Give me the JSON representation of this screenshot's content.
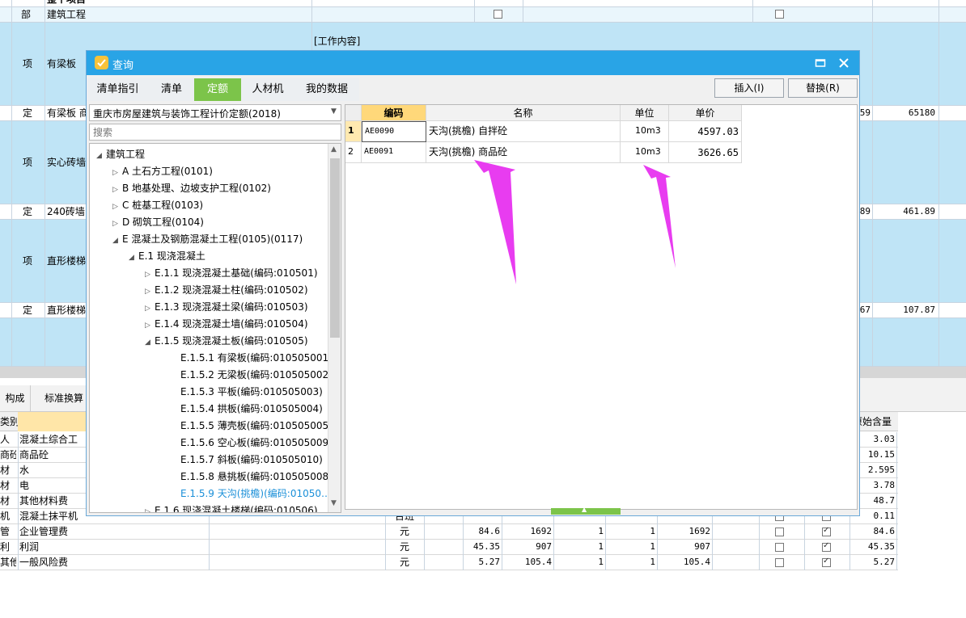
{
  "background": {
    "rows": [
      {
        "type": "部",
        "name": "建筑工程"
      },
      {
        "type": "项",
        "name": "有梁板",
        "content": "[工作内容]"
      },
      {
        "type": "定",
        "name": "有梁板 商",
        "v1": "59",
        "v2": "65180"
      },
      {
        "type": "项",
        "name": "实心砖墙"
      },
      {
        "type": "定",
        "name": "240砖墙",
        "v1": "89",
        "v2": "461.89"
      },
      {
        "type": "项",
        "name": "直形楼梯"
      },
      {
        "type": "定",
        "name": "直形楼梯",
        "v1": "67",
        "v2": "107.87"
      }
    ],
    "header_top": "整个项目",
    "bottom_tabs": [
      "构成",
      "标准换算"
    ],
    "bottom_header": {
      "col1": "类别",
      "last": "原始含量"
    },
    "bottom_rows": [
      {
        "type": "人",
        "name": "混凝土综合工",
        "unit": "",
        "price": "",
        "total": "",
        "q": "",
        "qty": "",
        "amount": "",
        "c1": false,
        "c2": false,
        "orig": "3.03"
      },
      {
        "type": "商砼",
        "name": "商品砼",
        "unit": "",
        "price": "",
        "total": "",
        "q": "",
        "qty": "",
        "amount": "",
        "c1": false,
        "c2": false,
        "orig": "10.15"
      },
      {
        "type": "材",
        "name": "水",
        "unit": "",
        "price": "",
        "total": "",
        "q": "",
        "qty": "",
        "amount": "",
        "c1": false,
        "c2": false,
        "orig": "2.595"
      },
      {
        "type": "材",
        "name": "电",
        "unit": "",
        "price": "",
        "total": "",
        "q": "",
        "qty": "",
        "amount": "",
        "c1": false,
        "c2": false,
        "orig": "3.78"
      },
      {
        "type": "材",
        "name": "其他材料费",
        "unit": "",
        "price": "",
        "total": "",
        "q": "",
        "qty": "",
        "amount": "",
        "c1": false,
        "c2": false,
        "orig": "48.7"
      },
      {
        "type": "机",
        "name": "混凝土抹平机",
        "unit": "台班",
        "price": "",
        "total": "",
        "q": "",
        "qty": "",
        "amount": "",
        "c1": false,
        "c2": false,
        "orig": "0.11"
      },
      {
        "type": "管",
        "name": "企业管理费",
        "unit": "元",
        "price": "84.6",
        "total": "1692",
        "q": "1",
        "qty": "1",
        "amount": "1692",
        "c1": false,
        "c2": true,
        "orig": "84.6"
      },
      {
        "type": "利",
        "name": "利润",
        "unit": "元",
        "price": "45.35",
        "total": "907",
        "q": "1",
        "qty": "1",
        "amount": "907",
        "c1": false,
        "c2": true,
        "orig": "45.35"
      },
      {
        "type": "其他",
        "name": "一般风险费",
        "unit": "元",
        "price": "5.27",
        "total": "105.4",
        "q": "1",
        "qty": "1",
        "amount": "105.4",
        "c1": false,
        "c2": true,
        "orig": "5.27"
      }
    ]
  },
  "dialog": {
    "title": "查询",
    "tabs": [
      "清单指引",
      "清单",
      "定额",
      "人材机",
      "我的数据"
    ],
    "active_tab": 2,
    "insert_label": "插入(I)",
    "replace_label": "替换(R)",
    "library": "重庆市房屋建筑与装饰工程计价定额(2018)",
    "search_placeholder": "搜索",
    "tree": [
      {
        "level": 0,
        "arrow": "down",
        "label": "建筑工程"
      },
      {
        "level": 1,
        "arrow": "right",
        "label": "A 土石方工程(0101)"
      },
      {
        "level": 1,
        "arrow": "right",
        "label": "B 地基处理、边坡支护工程(0102)"
      },
      {
        "level": 1,
        "arrow": "right",
        "label": "C 桩基工程(0103)"
      },
      {
        "level": 1,
        "arrow": "right",
        "label": "D 砌筑工程(0104)"
      },
      {
        "level": 1,
        "arrow": "down",
        "label": "E 混凝土及钢筋混凝土工程(0105)(0117)"
      },
      {
        "level": 2,
        "arrow": "down",
        "label": "E.1 现浇混凝土"
      },
      {
        "level": 3,
        "arrow": "right",
        "label": "E.1.1 现浇混凝土基础(编码:010501)"
      },
      {
        "level": 3,
        "arrow": "right",
        "label": "E.1.2 现浇混凝土柱(编码:010502)"
      },
      {
        "level": 3,
        "arrow": "right",
        "label": "E.1.3 现浇混凝土梁(编码:010503)"
      },
      {
        "level": 3,
        "arrow": "right",
        "label": "E.1.4 现浇混凝土墙(编码:010504)"
      },
      {
        "level": 3,
        "arrow": "down",
        "label": "E.1.5 现浇混凝土板(编码:010505)"
      },
      {
        "level": 4,
        "arrow": "",
        "label": "E.1.5.1 有梁板(编码:010505001)"
      },
      {
        "level": 4,
        "arrow": "",
        "label": "E.1.5.2 无梁板(编码:010505002)"
      },
      {
        "level": 4,
        "arrow": "",
        "label": "E.1.5.3 平板(编码:010505003)"
      },
      {
        "level": 4,
        "arrow": "",
        "label": "E.1.5.4 拱板(编码:010505004)"
      },
      {
        "level": 4,
        "arrow": "",
        "label": "E.1.5.5 薄壳板(编码:010505005)"
      },
      {
        "level": 4,
        "arrow": "",
        "label": "E.1.5.6 空心板(编码:010505009)"
      },
      {
        "level": 4,
        "arrow": "",
        "label": "E.1.5.7 斜板(编码:010505010)"
      },
      {
        "level": 4,
        "arrow": "",
        "label": "E.1.5.8 悬挑板(编码:010505008)"
      },
      {
        "level": 4,
        "arrow": "",
        "label": "E.1.5.9 天沟(挑檐)(编码:01050…",
        "selected": true
      },
      {
        "level": 3,
        "arrow": "right",
        "label": "E.1.6 现浇混凝土楼梯(编码:010506)"
      }
    ],
    "grid": {
      "headers": {
        "code": "编码",
        "name": "名称",
        "unit": "单位",
        "price": "单价"
      },
      "rows": [
        {
          "idx": "1",
          "code": "AE0090",
          "name": "天沟(挑檐) 自拌砼",
          "unit": "10m3",
          "price": "4597.03"
        },
        {
          "idx": "2",
          "code": "AE0091",
          "name": "天沟(挑檐) 商品砼",
          "unit": "10m3",
          "price": "3626.65"
        }
      ]
    },
    "annotation_color": "#e83cf0"
  }
}
